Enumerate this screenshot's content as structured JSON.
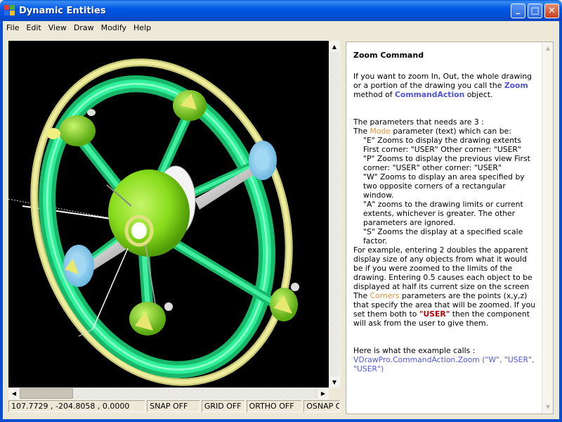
{
  "window": {
    "title": "Dynamic Entities",
    "minimize_glyph": "_",
    "maximize_glyph": "□",
    "close_glyph": "✕"
  },
  "menu": [
    "File",
    "Edit",
    "View",
    "Draw",
    "Modify",
    "Help"
  ],
  "status": {
    "coords": "107.7729 , -204.8058 , 0.0000",
    "snap": "SNAP OFF",
    "grid": "GRID OFF",
    "ortho": "ORTHO OFF",
    "osnap": "OSNAP OF"
  },
  "scroll": {
    "up": "▲",
    "down": "▼",
    "left": "◀",
    "right": "▶"
  },
  "help": {
    "heading": "Zoom Command",
    "intro_1": "If you want to zoom In, Out, the whole drawing or a portion of the drawing  you call the",
    "intro_zoom": "Zoom",
    "intro_2": "method of",
    "intro_commandaction": "CommandAction",
    "intro_3": "object.",
    "params_line": "The parameters that needs are 3 :",
    "mode_pre": "The",
    "mode_kw": "Mode",
    "mode_post": "parameter (text) which can be:",
    "e_line": "\"E\" Zooms to display the drawing extents First corner:     \"USER\" Other corner: \"USER\"",
    "p_line": "\"P\" Zooms to display the previous view First corner: \"USER\" other corner: \"USER\"",
    "w_line": "\"W\" Zooms to display an area specified by two opposite corners of a rectangular window.",
    "a_line": "\"A\" zooms to the drawing limits or current extents, whichever is greater. The other parameters are ignored.",
    "s_line": "\"S\" Zooms the display at a specified scale factor.",
    "example_text": "For example, entering 2 doubles the apparent display size of any objects from what it would be if you were zoomed to the limits of the drawing. Entering 0.5 causes each object to be displayed at half its current size on the screen",
    "corners_pre": "The",
    "corners_kw": "Corners",
    "corners_post": "parameters are the points (x,y,z) that specify the area that will be zoomed. If you set them both to",
    "user_kw": "\"USER\"",
    "corners_end": "then the component will ask from the user to give them.",
    "calls_line": "Here is what the example calls :",
    "call_code": "VDrawPro.CommandAction.Zoom (\"W\", \"USER\", \"USER\")"
  },
  "colors": {
    "titlebar": "#0058e6",
    "viewport_bg": "#000000",
    "wheel_green": "#22e08a",
    "wheel_yellow": "#e8e890",
    "hub_green": "#8ee020",
    "keyword_blue": "#4b54d8",
    "keyword_orange": "#e6953a",
    "keyword_red": "#b40000"
  }
}
